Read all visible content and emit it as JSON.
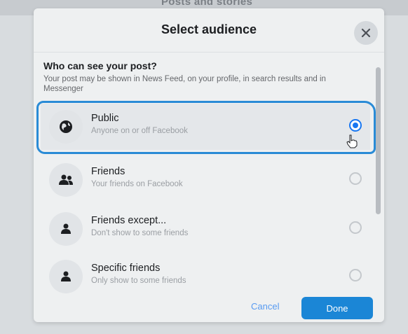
{
  "background": {
    "title": "Posts and stories"
  },
  "dialog": {
    "title": "Select audience",
    "question": "Who can see your post?",
    "description": "Your post may be shown in News Feed, on your profile, in search results and in Messenger",
    "options": [
      {
        "label": "Public",
        "sub": "Anyone on or off Facebook",
        "icon": "globe-icon",
        "selected": true
      },
      {
        "label": "Friends",
        "sub": "Your friends on Facebook",
        "icon": "friends-icon",
        "selected": false
      },
      {
        "label": "Friends except...",
        "sub": "Don't show to some friends",
        "icon": "friend-except-icon",
        "selected": false
      },
      {
        "label": "Specific friends",
        "sub": "Only show to some friends",
        "icon": "person-icon",
        "selected": false
      }
    ],
    "cancel_label": "Cancel",
    "done_label": "Done"
  },
  "colors": {
    "accent": "#1877f2",
    "done": "#1b86d6",
    "marker": "#2a8bd6"
  }
}
